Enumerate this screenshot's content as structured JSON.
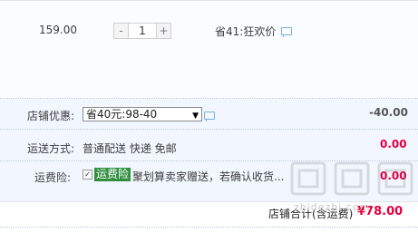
{
  "item": {
    "price": "159.00",
    "quantity": "1",
    "minus_label": "-",
    "plus_label": "+",
    "promotion": "省41:狂欢价"
  },
  "shop_discount": {
    "label": "店铺优惠:",
    "selected_option": "省40元:98-40",
    "amount": "-40.00"
  },
  "shipping": {
    "label": "运送方式:",
    "method": "普通配送 快递 免邮",
    "amount": "0.00"
  },
  "insurance": {
    "label": "运费险:",
    "badge": "运费险",
    "description": "聚划算卖家赠送，若确认收货...",
    "amount": "0.00",
    "checked": true
  },
  "total": {
    "label": "店铺合计(含运费)",
    "amount": "¥78.00"
  },
  "watermark": {
    "text": "zhidezhi.com"
  },
  "colors": {
    "accent_red": "#e4003f",
    "badge_green": "#2f8f3f",
    "options_bg": "#f2f7ff"
  }
}
